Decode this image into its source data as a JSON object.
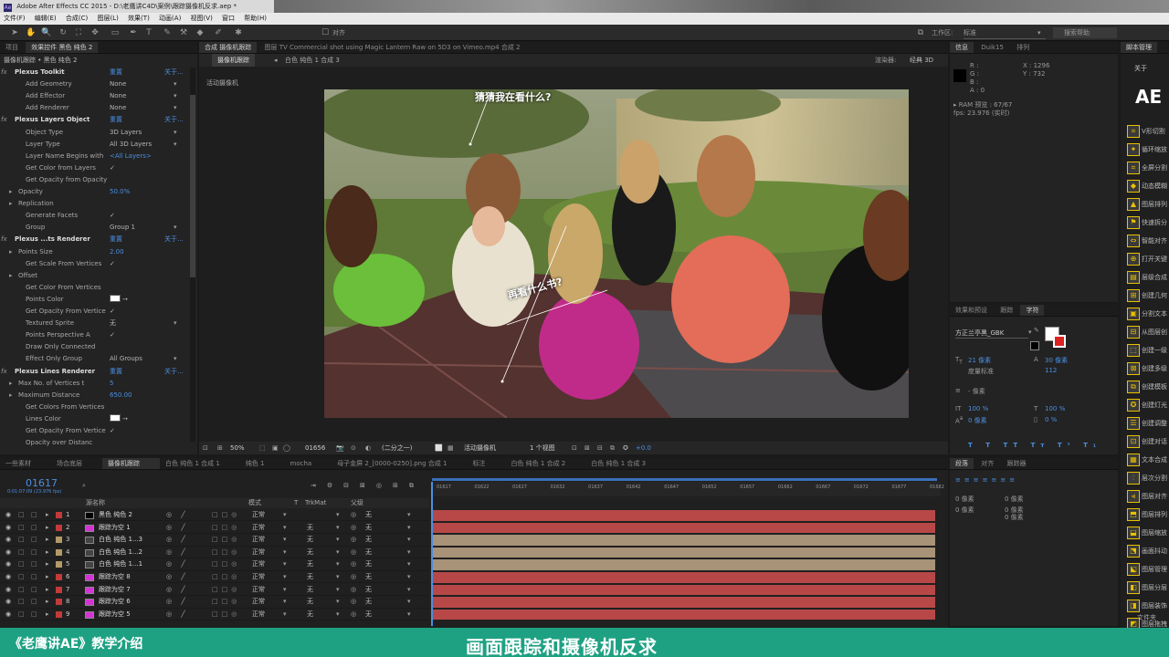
{
  "window": {
    "title": "Adobe After Effects CC 2015 - D:\\老鹰讲C4D\\案例\\跟踪摄像机反求.aep *",
    "app_icon": "Ae"
  },
  "menu": [
    "文件(F)",
    "编辑(E)",
    "合成(C)",
    "图层(L)",
    "效果(T)",
    "动画(A)",
    "视图(V)",
    "窗口",
    "帮助(H)"
  ],
  "toolbar": {
    "workspace_label": "工作区:",
    "workspace_value": "标准",
    "search_label": "搜索帮助",
    "snap_label": "对齐"
  },
  "effects_panel": {
    "tabs": [
      "项目",
      "效果控件 黑色 纯色 2"
    ],
    "subtitle": "摄像机跟踪 • 黑色 纯色 2",
    "rows": [
      {
        "indent": 0,
        "label": "Plexus Toolkit",
        "value": "重置",
        "about": "关于...",
        "header": true,
        "fx": true
      },
      {
        "indent": 1,
        "label": "Add Geometry",
        "value": "None",
        "dd": true
      },
      {
        "indent": 1,
        "label": "Add Effector",
        "value": "None",
        "dd": true
      },
      {
        "indent": 1,
        "label": "Add Renderer",
        "value": "None",
        "dd": true
      },
      {
        "indent": 0,
        "label": "Plexus Layers Object",
        "value": "重置",
        "about": "关于...",
        "header": true,
        "fx": true
      },
      {
        "indent": 1,
        "label": "Object Type",
        "value": "3D Layers",
        "dd": true
      },
      {
        "indent": 1,
        "label": "Layer Type",
        "value": "All 3D Layers",
        "dd": true
      },
      {
        "indent": 1,
        "label": "Layer Name Begins with",
        "value": "<All Layers>",
        "link": true
      },
      {
        "indent": 1,
        "label": "Get Color from Layers",
        "value": "✓"
      },
      {
        "indent": 1,
        "label": "Get Opacity from Opacity",
        "value": ""
      },
      {
        "indent": 1,
        "label": "Opacity",
        "value": "50.0%",
        "link": true,
        "twirl": true
      },
      {
        "indent": 1,
        "label": "Replication",
        "value": "",
        "twirl": true
      },
      {
        "indent": 1,
        "label": "Generate Facets",
        "value": "✓"
      },
      {
        "indent": 1,
        "label": "Group",
        "value": "Group 1",
        "dd": true
      },
      {
        "indent": 0,
        "label": "Plexus ...ts Renderer",
        "value": "重置",
        "about": "关于...",
        "header": true,
        "fx": true
      },
      {
        "indent": 1,
        "label": "Points Size",
        "value": "2.00",
        "link": true,
        "twirl": true
      },
      {
        "indent": 1,
        "label": "Get Scale From Vertices",
        "value": "✓"
      },
      {
        "indent": 1,
        "label": "Offset",
        "value": "",
        "twirl": true
      },
      {
        "indent": 1,
        "label": "Get Color From Vertices",
        "value": ""
      },
      {
        "indent": 1,
        "label": "Points Color",
        "value": "swatch"
      },
      {
        "indent": 1,
        "label": "Get Opacity From Vertice",
        "value": "✓"
      },
      {
        "indent": 1,
        "label": "Textured Sprite",
        "value": "无",
        "dd": true
      },
      {
        "indent": 1,
        "label": "Points Perspective A",
        "value": "✓"
      },
      {
        "indent": 1,
        "label": "Draw Only Connected",
        "value": ""
      },
      {
        "indent": 1,
        "label": "Effect Only Group",
        "value": "All Groups",
        "dd": true
      },
      {
        "indent": 0,
        "label": "Plexus Lines Renderer",
        "value": "重置",
        "about": "关于...",
        "header": true,
        "fx": true
      },
      {
        "indent": 1,
        "label": "Max No. of Vertices t",
        "value": "5",
        "link": true,
        "twirl": true
      },
      {
        "indent": 1,
        "label": "Maximum Distance",
        "value": "650.00",
        "link": true,
        "twirl": true
      },
      {
        "indent": 1,
        "label": "Get Colors From Vertices",
        "value": ""
      },
      {
        "indent": 1,
        "label": "Lines Color",
        "value": "swatch"
      },
      {
        "indent": 1,
        "label": "Get Opacity From Vertice",
        "value": "✓"
      },
      {
        "indent": 1,
        "label": "Opacity over Distanc",
        "value": ""
      }
    ]
  },
  "comp_panel": {
    "tabs": [
      "合成 摄像机跟踪",
      "图层 TV Commercial shot using Magic Lantern Raw on 5D3 on Vimeo.mp4 合成 2"
    ],
    "breadcrumb_left": "摄像机跟踪",
    "breadcrumb_right": "白色 纯色 1 合成 3",
    "renderer_label": "渲染器:",
    "renderer_value": "经典 3D",
    "view_label": "活动摄像机",
    "captions": [
      "猜猜我在看什么?",
      "再看什么书?"
    ],
    "footer": {
      "zoom": "50%",
      "timecode": "01656",
      "resolution": "(二分之一)",
      "camera": "活动摄像机",
      "views": "1 个视图",
      "exposure": "+0.0"
    }
  },
  "info_panel": {
    "tabs": [
      "信息",
      "Duik15",
      "排列"
    ],
    "r": "R :",
    "g": "G :",
    "b": "B :",
    "a": "A : 0",
    "x": "X : 1296",
    "y": "Y : 732",
    "ram": "▸ RAM 预览 : 67/67",
    "fps": "fps: 23.976 (实时)"
  },
  "char_panel": {
    "tabs": [
      "效果和预设",
      "跟踪",
      "字符"
    ],
    "font": "方正兰亭黑_GBK",
    "size": "21 像素",
    "leading": "30 像素",
    "tracking": "112",
    "kerning": "度量标准",
    "stroke": "- 像素",
    "vscale": "100 %",
    "hscale": "100 %",
    "baseline": "0 像素",
    "tsume": "0 %",
    "styles": [
      "T",
      "T",
      "TT",
      "Tт",
      "T¹",
      "T₁"
    ]
  },
  "para_panel": {
    "tabs": [
      "段落",
      "对齐",
      "跟踪器"
    ],
    "values": [
      "0 像素",
      "0 像素",
      "0 像素",
      "0 像素",
      "0 像素"
    ]
  },
  "scripts_panel": {
    "title": "脚本管理",
    "about": "关于",
    "logo": "AE",
    "items": [
      "V形切割",
      "循环缩放",
      "全屏分割",
      "动态模糊",
      "图层排列",
      "快速拆分",
      "智能对齐",
      "打开关键",
      "层级合成",
      "创建几何",
      "分割文本",
      "从图层创",
      "创建一级",
      "创建多级",
      "创建模板",
      "创建灯光",
      "创建调整",
      "创建对话",
      "文本合成",
      "层次分割",
      "图层对齐",
      "图层排列",
      "图层缩放",
      "画面抖动",
      "图层管理",
      "图层分层",
      "图层装饰",
      "图层拖拽",
      "按路径",
      "全屏装饰",
      "图层分帧"
    ],
    "footer": "文件夹"
  },
  "timeline": {
    "tabs": [
      "一些素材",
      "场合底层",
      "摄像机跟踪",
      "白色 纯色 1 合成 1",
      "纯色 1",
      "mocha",
      "母子金屏 2_[0000-0250].png 合成 1",
      "标注",
      "白色 纯色 1 合成 2",
      "白色 纯色 1 合成 3"
    ],
    "timecode": "01617",
    "timecode_sub": "0:01:07:09 (23.976 fps)",
    "col_source": "源名称",
    "col_mode": "模式",
    "col_t": "T",
    "col_trkmat": "TrkMat",
    "col_parent": "父级",
    "ruler": [
      "01617",
      "01622",
      "01627",
      "01632",
      "01637",
      "01642",
      "01647",
      "01652",
      "01657",
      "01662",
      "01667",
      "01672",
      "01677",
      "01682"
    ],
    "layers": [
      {
        "n": "1",
        "name": "黑色 纯色 2",
        "color": "#c23a3a",
        "type": "solid",
        "mode": "正常",
        "trk": "",
        "parent": "无",
        "bar": "#b84848"
      },
      {
        "n": "2",
        "name": "跟踪为空 1",
        "color": "#c23a3a",
        "type": "null",
        "mode": "正常",
        "trk": "无",
        "parent": "无",
        "bar": "#b84848"
      },
      {
        "n": "3",
        "name": "白色 纯色 1...3",
        "color": "#b39a66",
        "type": "comp",
        "mode": "正常",
        "trk": "无",
        "parent": "无",
        "bar": "#a89278"
      },
      {
        "n": "4",
        "name": "白色 纯色 1...2",
        "color": "#b39a66",
        "type": "comp",
        "mode": "正常",
        "trk": "无",
        "parent": "无",
        "bar": "#a89278"
      },
      {
        "n": "5",
        "name": "白色 纯色 1...1",
        "color": "#b39a66",
        "type": "comp",
        "mode": "正常",
        "trk": "无",
        "parent": "无",
        "bar": "#a89278"
      },
      {
        "n": "6",
        "name": "跟踪为空 8",
        "color": "#c23a3a",
        "type": "null",
        "mode": "正常",
        "trk": "无",
        "parent": "无",
        "bar": "#b84848"
      },
      {
        "n": "7",
        "name": "跟踪为空 7",
        "color": "#c23a3a",
        "type": "null",
        "mode": "正常",
        "trk": "无",
        "parent": "无",
        "bar": "#b84848"
      },
      {
        "n": "8",
        "name": "跟踪为空 6",
        "color": "#c23a3a",
        "type": "null",
        "mode": "正常",
        "trk": "无",
        "parent": "无",
        "bar": "#b84848"
      },
      {
        "n": "9",
        "name": "跟踪为空 5",
        "color": "#c23a3a",
        "type": "null",
        "mode": "正常",
        "trk": "无",
        "parent": "无",
        "bar": "#b84848"
      }
    ]
  },
  "banner": {
    "left": "《老鹰讲AE》教学介绍",
    "right": "画面跟踪和摄像机反求"
  },
  "colors": {
    "accent": "#4b8fe0",
    "banner": "#1ea183",
    "layer_red": "#c23a3a",
    "layer_tan": "#b39a66"
  }
}
